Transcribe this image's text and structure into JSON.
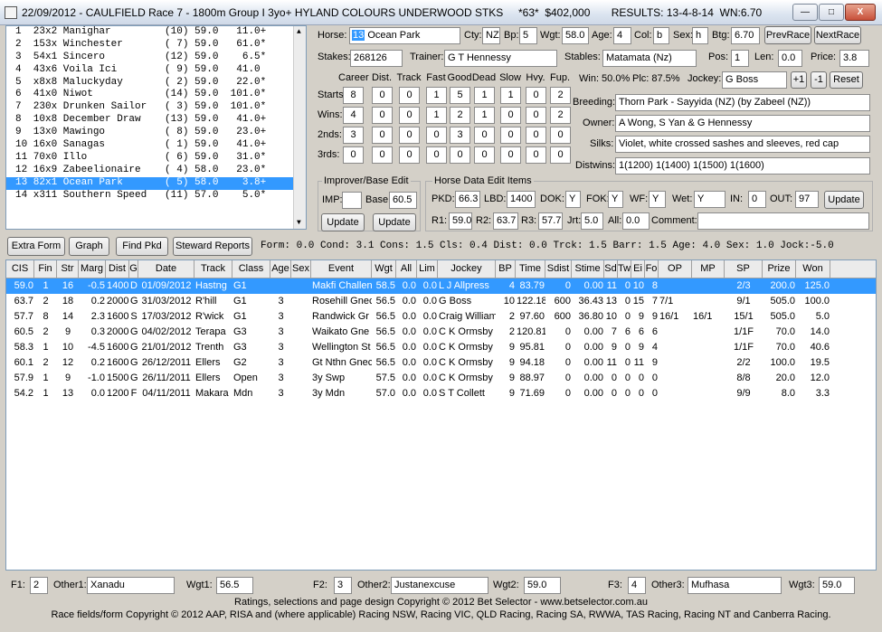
{
  "title": "22/09/2012 - CAULFIELD Race 7 - 1800m Group I 3yo+ HYLAND COLOURS UNDERWOOD STKS     *63*  $402,000       RESULTS: 13-4-8-14  WN:6.70",
  "window_buttons": {
    "minimize": "—",
    "maximize": "□",
    "close": "X"
  },
  "runners": [
    "1  23x2 Manighar         (10) 59.0   11.0+",
    "2  153x Winchester       ( 7) 59.0   61.0*",
    "3  54x1 Sincero          (12) 59.0    6.5*",
    "4  43x6 Voila Ici        ( 9) 59.0   41.0",
    "5  x8x8 Maluckyday       ( 2) 59.0   22.0*",
    "6  41x0 Niwot            (14) 59.0  101.0*",
    "7  230x Drunken Sailor   ( 3) 59.0  101.0*",
    "8  10x8 December Draw    (13) 59.0   41.0+",
    "9  13x0 Mawingo          ( 8) 59.0   23.0+",
    "10 16x0 Sanagas          ( 1) 59.0   41.0+",
    "11 70x0 Illo             ( 6) 59.0   31.0*",
    "12 16x9 Zabeelionaire    ( 4) 58.0   23.0*",
    "13 82x1 Ocean Park       ( 5) 58.0    3.8+",
    "14 x311 Southern Speed   (11) 57.0    5.0*"
  ],
  "horse": {
    "num": "13",
    "name": "Ocean Park",
    "cty_label": "Cty:",
    "cty": "NZ",
    "bp_label": "Bp:",
    "bp": "5",
    "wgt_label": "Wgt:",
    "wgt": "58.0",
    "age_label": "Age:",
    "age": "4",
    "col_label": "Col:",
    "col": "b",
    "sex_label": "Sex:",
    "sex": "h",
    "btg_label": "Btg:",
    "btg": "6.70",
    "label": "Horse:"
  },
  "nav": {
    "prev": "PrevRace",
    "next": "NextRace"
  },
  "stakes": {
    "label": "Stakes:",
    "value": "268126",
    "trainer_label": "Trainer:",
    "trainer": "G T Hennessy",
    "stables_label": "Stables:",
    "stables": "Matamata (Nz)",
    "pos_label": "Pos:",
    "pos": "1",
    "len_label": "Len:",
    "len": "0.0",
    "price_label": "Price:",
    "price": "3.8"
  },
  "career": {
    "cols": [
      "Career",
      "Dist.",
      "Track",
      "Fast",
      "Good",
      "Dead",
      "Slow",
      "Hvy.",
      "Fup."
    ],
    "rows": [
      {
        "label": "Starts:",
        "v": [
          "8",
          "0",
          "0",
          "1",
          "5",
          "1",
          "1",
          "0",
          "2"
        ]
      },
      {
        "label": "Wins:",
        "v": [
          "4",
          "0",
          "0",
          "1",
          "2",
          "1",
          "0",
          "0",
          "2"
        ]
      },
      {
        "label": "2nds:",
        "v": [
          "3",
          "0",
          "0",
          "0",
          "3",
          "0",
          "0",
          "0",
          "0"
        ]
      },
      {
        "label": "3rds:",
        "v": [
          "0",
          "0",
          "0",
          "0",
          "0",
          "0",
          "0",
          "0",
          "0"
        ]
      }
    ]
  },
  "win_pct": "Win: 50.0%",
  "plc_pct": "Plc: 87.5%",
  "jockey_label": "Jockey:",
  "jockey": "G Boss",
  "plus": "+1",
  "minus": "-1",
  "reset": "Reset",
  "breeding_label": "Breeding:",
  "breeding": "Thorn Park - Sayyida (NZ) (by Zabeel (NZ))",
  "owner_label": "Owner:",
  "owner": "A Wong, S Yan & G Hennessy",
  "silks_label": "Silks:",
  "silks": "Violet, white crossed sashes and sleeves, red cap",
  "distwins_label": "Distwins:",
  "distwins": "1(1200) 1(1400) 1(1500) 1(1600)",
  "improver": {
    "title": "Improver/Base Edit",
    "imp_label": "IMP:",
    "imp": "",
    "base_label": "Base:",
    "base": "60.5",
    "upd1": "Update",
    "upd2": "Update"
  },
  "hde": {
    "title": "Horse Data Edit Items",
    "pkd_label": "PKD:",
    "pkd": "66.3",
    "lbd_label": "LBD:",
    "lbd": "1400",
    "dok_label": "DOK:",
    "dok": "Y",
    "fok_label": "FOK:",
    "fok": "Y",
    "wf_label": "WF:",
    "wf": "Y",
    "wet_label": "Wet:",
    "wet": "Y",
    "in_label": "IN:",
    "in": "0",
    "out_label": "OUT:",
    "out": "97",
    "update": "Update",
    "r1_label": "R1:",
    "r1": "59.0",
    "r2_label": "R2:",
    "r2": "63.7",
    "r3_label": "R3:",
    "r3": "57.7",
    "jrt_label": "Jrt:",
    "jrt": "5.0",
    "all_label": "All:",
    "all": "0.0",
    "comment_label": "Comment:",
    "comment": ""
  },
  "toolbar": {
    "extra": "Extra Form",
    "graph": "Graph",
    "findpkd": "Find Pkd",
    "steward": "Steward Reports",
    "summary": "Form: 0.0 Cond: 3.1 Cons: 1.5 Cls: 0.4 Dist: 0.0 Trck: 1.5 Barr: 1.5 Age: 4.0 Sex: 1.0 Jock:-5.0"
  },
  "grid": {
    "headers": [
      "CIS",
      "Fin",
      "Str",
      "Marg",
      "Dist",
      "G",
      "Date",
      "Track",
      "Class",
      "Age",
      "Sex",
      "Event",
      "Wgt",
      "All",
      "Lim",
      "Jockey",
      "BP",
      "Time",
      "Sdist",
      "Stime",
      "Sd",
      "Tw",
      "Ei",
      "Fo",
      "OP",
      "MP",
      "SP",
      "Prize",
      "Won"
    ],
    "rows": [
      [
        "59.0",
        "1",
        "16",
        "-0.5",
        "1400",
        "D",
        "01/09/2012",
        "Hastng",
        "G1",
        "",
        "",
        "Makfi Challen",
        "58.5",
        "0.0",
        "0.0",
        "L J Allpress",
        "4",
        "83.79",
        "0",
        "0.00",
        "11",
        "0",
        "10",
        "8",
        "",
        "",
        "2/3",
        "200.0",
        "125.0"
      ],
      [
        "63.7",
        "2",
        "18",
        "0.2",
        "2000",
        "G",
        "31/03/2012",
        "R'hill",
        "G1",
        "3",
        "",
        "Rosehill Gnec",
        "56.5",
        "0.0",
        "0.0",
        "G Boss",
        "10",
        "122.18",
        "600",
        "36.43",
        "13",
        "0",
        "15",
        "7",
        "7/1",
        "",
        "9/1",
        "505.0",
        "100.0"
      ],
      [
        "57.7",
        "8",
        "14",
        "2.3",
        "1600",
        "S",
        "17/03/2012",
        "R'wick",
        "G1",
        "3",
        "",
        "Randwick Gr",
        "56.5",
        "0.0",
        "0.0",
        "Craig Williams",
        "2",
        "97.60",
        "600",
        "36.80",
        "10",
        "0",
        "9",
        "9",
        "16/1",
        "16/1",
        "15/1",
        "505.0",
        "5.0"
      ],
      [
        "60.5",
        "2",
        "9",
        "0.3",
        "2000",
        "G",
        "04/02/2012",
        "Terapa",
        "G3",
        "3",
        "",
        "Waikato Gne",
        "56.5",
        "0.0",
        "0.0",
        "C K Ormsby",
        "2",
        "120.81",
        "0",
        "0.00",
        "7",
        "6",
        "6",
        "6",
        "",
        "",
        "1/1F",
        "70.0",
        "14.0"
      ],
      [
        "58.3",
        "1",
        "10",
        "-4.5",
        "1600",
        "G",
        "21/01/2012",
        "Trenth",
        "G3",
        "3",
        "",
        "Wellington St",
        "56.5",
        "0.0",
        "0.0",
        "C K Ormsby",
        "9",
        "95.81",
        "0",
        "0.00",
        "9",
        "0",
        "9",
        "4",
        "",
        "",
        "1/1F",
        "70.0",
        "40.6"
      ],
      [
        "60.1",
        "2",
        "12",
        "0.2",
        "1600",
        "G",
        "26/12/2011",
        "Ellers",
        "G2",
        "3",
        "",
        "Gt Nthn Gnec",
        "56.5",
        "0.0",
        "0.0",
        "C K Ormsby",
        "9",
        "94.18",
        "0",
        "0.00",
        "11",
        "0",
        "11",
        "9",
        "",
        "",
        "2/2",
        "100.0",
        "19.5"
      ],
      [
        "57.9",
        "1",
        "9",
        "-1.0",
        "1500",
        "G",
        "26/11/2011",
        "Ellers",
        "Open",
        "3",
        "",
        "3y Swp",
        "57.5",
        "0.0",
        "0.0",
        "C K Ormsby",
        "9",
        "88.97",
        "0",
        "0.00",
        "0",
        "0",
        "0",
        "0",
        "",
        "",
        "8/8",
        "20.0",
        "12.0"
      ],
      [
        "54.2",
        "1",
        "13",
        "0.0",
        "1200",
        "F",
        "04/11/2011",
        "Makara",
        "Mdn",
        "3",
        "",
        "3y Mdn",
        "57.0",
        "0.0",
        "0.0",
        "S T Collett",
        "9",
        "71.69",
        "0",
        "0.00",
        "0",
        "0",
        "0",
        "0",
        "",
        "",
        "9/9",
        "8.0",
        "3.3"
      ]
    ]
  },
  "bottom": {
    "f1_label": "F1:",
    "f1": "2",
    "o1_label": "Other1:",
    "o1": "Xanadu",
    "w1_label": "Wgt1:",
    "w1": "56.5",
    "f2_label": "F2:",
    "f2": "3",
    "o2_label": "Other2:",
    "o2": "Justanexcuse",
    "w2_label": "Wgt2:",
    "w2": "59.0",
    "f3_label": "F3:",
    "f3": "4",
    "o3_label": "Other3:",
    "o3": "Mufhasa",
    "w3_label": "Wgt3:",
    "w3": "59.0"
  },
  "footer": {
    "line1": "Ratings, selections and page design Copyright © 2012 Bet Selector - www.betselector.com.au",
    "line2": "Race fields/form Copyright © 2012 AAP, RISA and (where applicable) Racing NSW, Racing VIC, QLD Racing, Racing SA, RWWA, TAS Racing, Racing NT and Canberra Racing."
  }
}
